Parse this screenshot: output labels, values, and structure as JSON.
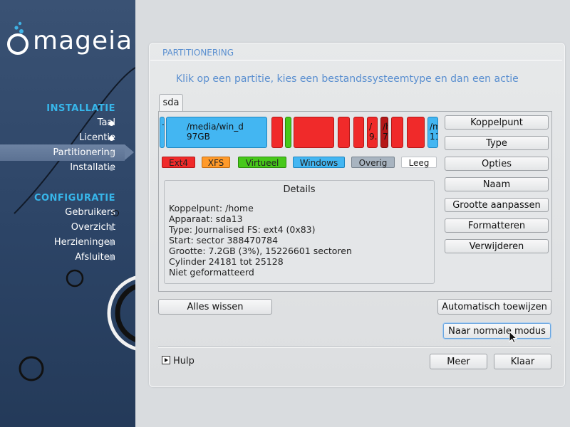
{
  "brand": {
    "name": "mageia"
  },
  "sidebar": {
    "sections": [
      {
        "title": "INSTALLATIE",
        "items": [
          {
            "label": "Taal",
            "state": "done"
          },
          {
            "label": "Licentie",
            "state": "done"
          },
          {
            "label": "Partitionering",
            "state": "active"
          },
          {
            "label": "Installatie",
            "state": "todo"
          }
        ]
      },
      {
        "title": "CONFIGURATIE",
        "items": [
          {
            "label": "Gebruikers",
            "state": "todo"
          },
          {
            "label": "Overzicht",
            "state": "todo"
          },
          {
            "label": "Herzieningen",
            "state": "todo"
          },
          {
            "label": "Afsluiten",
            "state": "todo"
          }
        ]
      }
    ]
  },
  "panel": {
    "title": "PARTITIONERING",
    "instruction": "Klik op een partitie, kies een bestandssysteemtype en dan een actie",
    "disk_tab": "sda",
    "partitions": [
      {
        "type": "Windows",
        "color": "#43b6f2",
        "line1": ".",
        "line2": ""
      },
      {
        "type": "Windows",
        "color": "#43b6f2",
        "line1": "/media/win_d",
        "line2": "97GB"
      },
      {
        "type": "Ext4",
        "color": "#f02a2a",
        "line1": "",
        "line2": ""
      },
      {
        "type": "Virtueel",
        "color": "#47c81a",
        "line1": "",
        "line2": ""
      },
      {
        "type": "Ext4",
        "color": "#f02a2a",
        "line1": "",
        "line2": ""
      },
      {
        "type": "Ext4",
        "color": "#f02a2a",
        "line1": "",
        "line2": ""
      },
      {
        "type": "Ext4",
        "color": "#f02a2a",
        "line1": "",
        "line2": ""
      },
      {
        "type": "Ext4",
        "color": "#f02a2a",
        "line1": "/",
        "line2": "9."
      },
      {
        "type": "Ext4",
        "color": "#b51818",
        "line1": "/h",
        "line2": "7."
      },
      {
        "type": "Ext4",
        "color": "#f02a2a",
        "line1": "",
        "line2": ""
      },
      {
        "type": "Ext4",
        "color": "#f02a2a",
        "line1": "",
        "line2": ""
      },
      {
        "type": "Windows",
        "color": "#43b6f2",
        "line1": "/m",
        "line2": "11"
      }
    ],
    "legend": [
      {
        "label": "Ext4",
        "color": "#f02a2a"
      },
      {
        "label": "XFS",
        "color": "#ff9a2a"
      },
      {
        "label": "Virtueel",
        "color": "#47c81a"
      },
      {
        "label": "Windows",
        "color": "#43b6f2"
      },
      {
        "label": "Overig",
        "color": "#a8b4c0"
      },
      {
        "label": "Leeg",
        "color": "#ffffff"
      }
    ],
    "details": {
      "title": "Details",
      "lines": [
        "Koppelpunt: /home",
        "Apparaat: sda13",
        "Type: Journalised FS: ext4 (0x83)",
        "Start: sector 388470784",
        "Grootte: 7.2GB (3%), 15226601 sectoren",
        "Cylinder 24181 tot 25128",
        "Niet geformatteerd"
      ]
    },
    "actions": [
      "Koppelpunt",
      "Type",
      "Opties",
      "Naam",
      "Grootte aanpassen",
      "Formatteren",
      "Verwijderen"
    ],
    "buttons": {
      "clear_all": "Alles wissen",
      "auto_allocate": "Automatisch toewijzen",
      "normal_mode": "Naar normale modus",
      "help": "Hulp",
      "more": "Meer",
      "done": "Klaar"
    }
  }
}
